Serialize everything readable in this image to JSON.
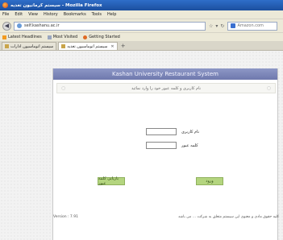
{
  "window": {
    "title": "سیستم کرمانیون تغذیه - Mozilla Firefox"
  },
  "menu": {
    "items": [
      "File",
      "Edit",
      "View",
      "History",
      "Bookmarks",
      "Tools",
      "Help"
    ]
  },
  "nav": {
    "url": "self.kashanu.ac.ir",
    "search_placeholder": "Amazon.com"
  },
  "bookmarks": {
    "items": [
      "Latest Headlines",
      "Most Visited",
      "Getting Started"
    ]
  },
  "tabs": [
    {
      "label": "سیستم اتوماسیون ادارات"
    },
    {
      "label": "سیستم اتوماسیون تغذیه"
    }
  ],
  "page": {
    "banner": "Kashan University Restaurant System",
    "message": "نام کاربری و کلمه عبور خود را وارد نمائید",
    "username_label": "نام کاربری",
    "password_label": "کلمه عبور",
    "forgot_button": "بازیابی کلمه عبور",
    "login_button": "ورود",
    "version": "Version : 7.91",
    "copyright": "کلیه حقوق مادی و معنوی این سیستم متعلق به شرکت ... می باشد"
  },
  "colors": {
    "banner": "#7b85b8",
    "button": "#b4d57f",
    "titlebar": "#2f6ec9"
  }
}
